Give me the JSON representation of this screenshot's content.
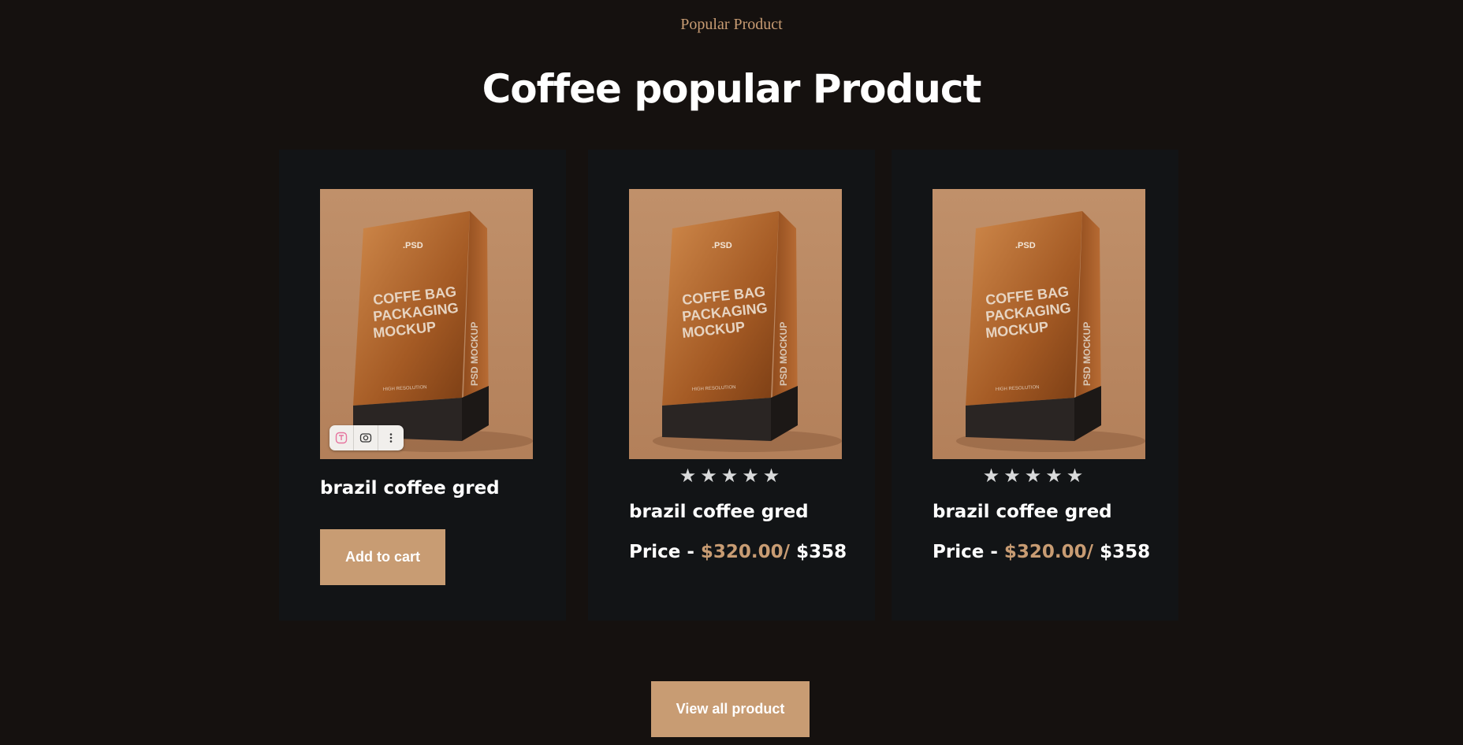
{
  "section": {
    "eyebrow": "Popular Product",
    "title": "Coffee popular Product"
  },
  "products": [
    {
      "name": "brazil coffee gred",
      "cart_label": "Add to cart",
      "image_alt": "coffee bag packaging mockup"
    },
    {
      "name": "brazil coffee gred",
      "rating": "★★★★★",
      "price_prefix": "Price - ",
      "price_sale": "$320.00/",
      "price_regular": " $358"
    },
    {
      "name": "brazil coffee gred",
      "rating": "★★★★★",
      "price_prefix": "Price - ",
      "price_sale": "$320.00/",
      "price_regular": " $358"
    }
  ],
  "footer": {
    "view_all_label": "View all product"
  },
  "colors": {
    "background": "#15110f",
    "card": "#121416",
    "accent": "#c89c73"
  },
  "icons": [
    "text-recognition-icon",
    "lens-search-icon",
    "more-options-icon"
  ]
}
